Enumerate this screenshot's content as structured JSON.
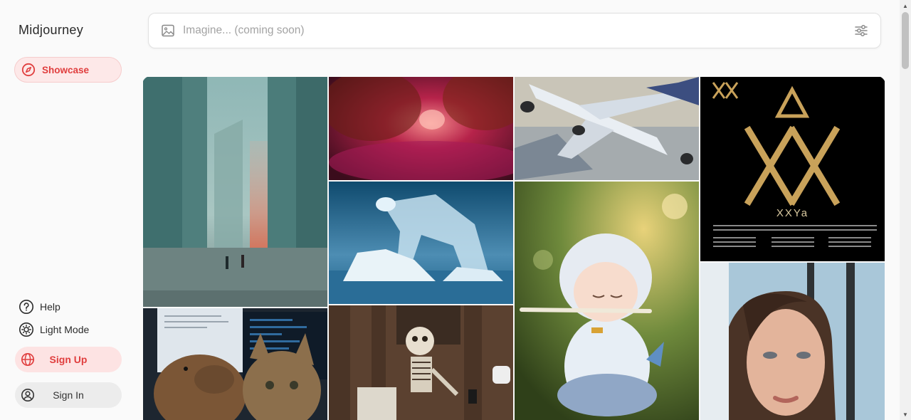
{
  "app": {
    "brand": "Midjourney"
  },
  "sidebar": {
    "showcase": {
      "label": "Showcase",
      "icon": "compass-icon"
    },
    "help": {
      "label": "Help",
      "icon": "question-circle-icon"
    },
    "mode": {
      "label": "Light Mode",
      "icon": "sun-icon"
    },
    "signup": {
      "label": "Sign Up",
      "icon": "globe-icon"
    },
    "signin": {
      "label": "Sign In",
      "icon": "user-circle-icon"
    }
  },
  "search": {
    "placeholder": "Imagine... (coming soon)",
    "value": "",
    "left_icon": "image-icon",
    "right_icon": "filter-sliders-icon"
  },
  "gallery": {
    "tiles": [
      {
        "id": "fog-buildings",
        "alt": "Foggy city with tall buildings and two figures"
      },
      {
        "id": "crimson-cave",
        "alt": "Glowing crimson cave"
      },
      {
        "id": "airplane",
        "alt": "Airplane over city painting"
      },
      {
        "id": "xxya-poster",
        "alt": "XXYA poster",
        "poster_text": "XXYa"
      },
      {
        "id": "ice-bear",
        "alt": "Glass polar bear on iceberg"
      },
      {
        "id": "flute-figurine",
        "alt": "Figurine playing flute"
      },
      {
        "id": "capybara-cat",
        "alt": "Capybara and cat at computer"
      },
      {
        "id": "skeleton",
        "alt": "Skeleton with phone"
      },
      {
        "id": "portrait",
        "alt": "Portrait of woman"
      }
    ]
  },
  "colors": {
    "accent": "#e03e3e",
    "accent_bg": "#fde8e8",
    "background": "#fafafa"
  }
}
